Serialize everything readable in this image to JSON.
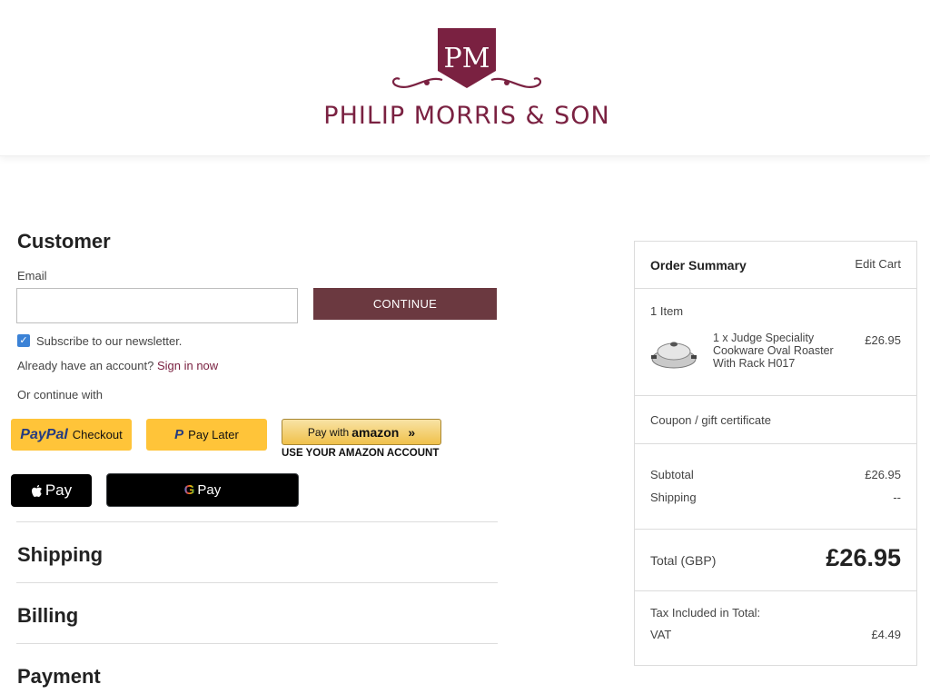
{
  "brand": {
    "name": "PHILIP MORRIS & SON",
    "logo_monogram": "PM",
    "primary_color": "#7a2141"
  },
  "customer": {
    "title": "Customer",
    "email_label": "Email",
    "email_value": "",
    "continue_label": "CONTINUE",
    "newsletter_label": "Subscribe to our newsletter.",
    "newsletter_checked": true,
    "account_prompt": "Already have an account?",
    "sign_in_label": "Sign in now",
    "or_continue_label": "Or continue with"
  },
  "payment_buttons": {
    "paypal_brand": "PayPal",
    "paypal_label": "Checkout",
    "paylater_label": "Pay Later",
    "amazon_label": "Pay with",
    "amazon_brand": "amazon",
    "amazon_caption": "USE YOUR AMAZON ACCOUNT",
    "applepay_label": "Pay",
    "gpay_label": "Pay"
  },
  "steps": {
    "shipping": "Shipping",
    "billing": "Billing",
    "payment": "Payment"
  },
  "order_summary": {
    "title": "Order Summary",
    "edit_cart_label": "Edit Cart",
    "item_count": "1 Item",
    "items": [
      {
        "description": "1 x Judge Speciality Cookware Oval Roaster With Rack H017",
        "price": "£26.95"
      }
    ],
    "coupon_label": "Coupon / gift certificate",
    "subtotal_label": "Subtotal",
    "subtotal_value": "£26.95",
    "shipping_label": "Shipping",
    "shipping_value": "--",
    "total_label": "Total (GBP)",
    "total_value": "£26.95",
    "tax_label": "Tax Included in Total:",
    "vat_label": "VAT",
    "vat_value": "£4.49"
  }
}
